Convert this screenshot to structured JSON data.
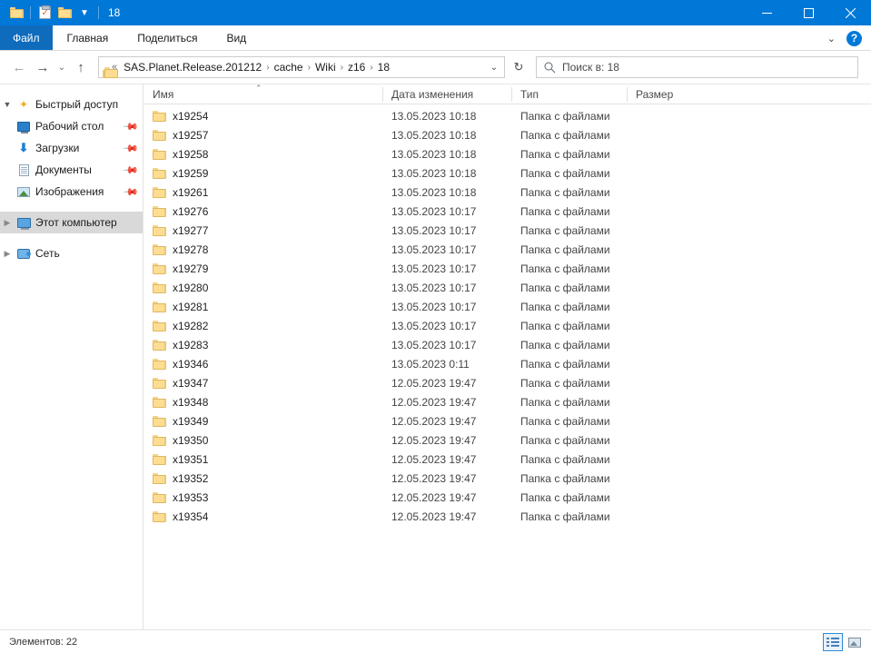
{
  "titlebar": {
    "title": "18",
    "quick_access": [
      {
        "name": "folder-icon",
        "label": "Свойства папки"
      },
      {
        "name": "properties-icon",
        "label": "Свойства"
      },
      {
        "name": "new-folder-icon",
        "label": "Создать папку"
      },
      {
        "name": "chevron-down-icon",
        "label": "Настроить панель быстрого доступа"
      }
    ],
    "controls": {
      "minimize": "─",
      "maximize": "☐",
      "close": "✕"
    }
  },
  "ribbon": {
    "tabs": [
      {
        "label": "Файл",
        "active": true
      },
      {
        "label": "Главная",
        "active": false
      },
      {
        "label": "Поделиться",
        "active": false
      },
      {
        "label": "Вид",
        "active": false
      }
    ],
    "collapse_icon": "⌄",
    "help_label": "?"
  },
  "navbar": {
    "back_icon": "←",
    "forward_icon": "→",
    "recent_icon": "⌄",
    "up_icon": "↑",
    "refresh_icon": "↻",
    "address_dropdown_icon": "⌄",
    "breadcrumb_lead": "«",
    "breadcrumbs": [
      "SAS.Planet.Release.201212",
      "cache",
      "Wiki",
      "z16",
      "18"
    ],
    "breadcrumb_separator": "›"
  },
  "search": {
    "icon": "search-icon",
    "placeholder": "Поиск в: 18"
  },
  "sidebar": {
    "items": [
      {
        "label": "Быстрый доступ",
        "icon": "star-icon",
        "expander": "open",
        "indent": 0,
        "pinned": false,
        "selected": false
      },
      {
        "label": "Рабочий стол",
        "icon": "desktop-icon",
        "expander": "none",
        "indent": 1,
        "pinned": true,
        "selected": false
      },
      {
        "label": "Загрузки",
        "icon": "downloads-icon",
        "expander": "none",
        "indent": 1,
        "pinned": true,
        "selected": false
      },
      {
        "label": "Документы",
        "icon": "documents-icon",
        "expander": "none",
        "indent": 1,
        "pinned": true,
        "selected": false
      },
      {
        "label": "Изображения",
        "icon": "pictures-icon",
        "expander": "none",
        "indent": 1,
        "pinned": true,
        "selected": false
      },
      {
        "label": "Этот компьютер",
        "icon": "computer-icon",
        "expander": "closed",
        "indent": 0,
        "pinned": false,
        "selected": true
      },
      {
        "label": "Сеть",
        "icon": "network-icon",
        "expander": "closed",
        "indent": 0,
        "pinned": false,
        "selected": false
      }
    ]
  },
  "filelist": {
    "columns": [
      {
        "label": "Имя",
        "sorted": "asc",
        "sort_caret": "⌃"
      },
      {
        "label": "Дата изменения",
        "sorted": null
      },
      {
        "label": "Тип",
        "sorted": null
      },
      {
        "label": "Размер",
        "sorted": null
      }
    ],
    "rows": [
      {
        "name": "x19254",
        "modified": "13.05.2023 10:18",
        "type": "Папка с файлами",
        "size": ""
      },
      {
        "name": "x19257",
        "modified": "13.05.2023 10:18",
        "type": "Папка с файлами",
        "size": ""
      },
      {
        "name": "x19258",
        "modified": "13.05.2023 10:18",
        "type": "Папка с файлами",
        "size": ""
      },
      {
        "name": "x19259",
        "modified": "13.05.2023 10:18",
        "type": "Папка с файлами",
        "size": ""
      },
      {
        "name": "x19261",
        "modified": "13.05.2023 10:18",
        "type": "Папка с файлами",
        "size": ""
      },
      {
        "name": "x19276",
        "modified": "13.05.2023 10:17",
        "type": "Папка с файлами",
        "size": ""
      },
      {
        "name": "x19277",
        "modified": "13.05.2023 10:17",
        "type": "Папка с файлами",
        "size": ""
      },
      {
        "name": "x19278",
        "modified": "13.05.2023 10:17",
        "type": "Папка с файлами",
        "size": ""
      },
      {
        "name": "x19279",
        "modified": "13.05.2023 10:17",
        "type": "Папка с файлами",
        "size": ""
      },
      {
        "name": "x19280",
        "modified": "13.05.2023 10:17",
        "type": "Папка с файлами",
        "size": ""
      },
      {
        "name": "x19281",
        "modified": "13.05.2023 10:17",
        "type": "Папка с файлами",
        "size": ""
      },
      {
        "name": "x19282",
        "modified": "13.05.2023 10:17",
        "type": "Папка с файлами",
        "size": ""
      },
      {
        "name": "x19283",
        "modified": "13.05.2023 10:17",
        "type": "Папка с файлами",
        "size": ""
      },
      {
        "name": "x19346",
        "modified": "13.05.2023 0:11",
        "type": "Папка с файлами",
        "size": ""
      },
      {
        "name": "x19347",
        "modified": "12.05.2023 19:47",
        "type": "Папка с файлами",
        "size": ""
      },
      {
        "name": "x19348",
        "modified": "12.05.2023 19:47",
        "type": "Папка с файлами",
        "size": ""
      },
      {
        "name": "x19349",
        "modified": "12.05.2023 19:47",
        "type": "Папка с файлами",
        "size": ""
      },
      {
        "name": "x19350",
        "modified": "12.05.2023 19:47",
        "type": "Папка с файлами",
        "size": ""
      },
      {
        "name": "x19351",
        "modified": "12.05.2023 19:47",
        "type": "Папка с файлами",
        "size": ""
      },
      {
        "name": "x19352",
        "modified": "12.05.2023 19:47",
        "type": "Папка с файлами",
        "size": ""
      },
      {
        "name": "x19353",
        "modified": "12.05.2023 19:47",
        "type": "Папка с файлами",
        "size": ""
      },
      {
        "name": "x19354",
        "modified": "12.05.2023 19:47",
        "type": "Папка с файлами",
        "size": ""
      }
    ]
  },
  "statusbar": {
    "item_count_text": "Элементов: 22",
    "views": [
      {
        "name": "details-view-button",
        "active": true
      },
      {
        "name": "large-icons-view-button",
        "active": false
      }
    ]
  },
  "colors": {
    "titlebar": "#0078d7",
    "file_tab": "#0f6cbd",
    "selection": "#d9d9d9",
    "hover": "#e5f1fb",
    "folder": "#fcdd92"
  }
}
